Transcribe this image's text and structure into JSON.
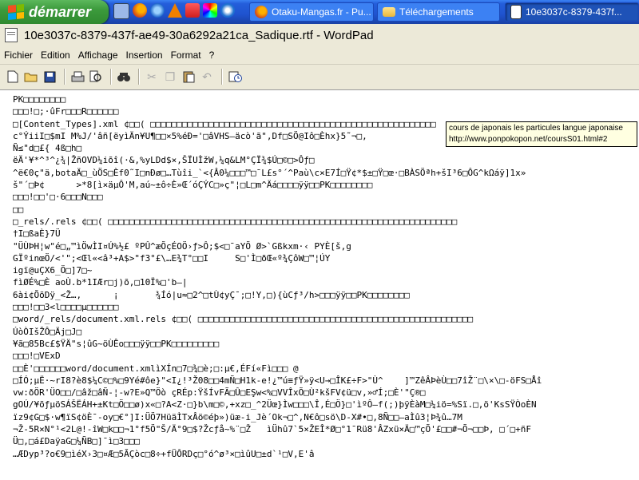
{
  "taskbar": {
    "start_label": "démarrer",
    "tasks": [
      {
        "label": "Otaku-Mangas.fr - Pu...",
        "icon": "firefox-icon"
      },
      {
        "label": "Téléchargements",
        "icon": "folder-icon"
      },
      {
        "label": "10e3037c-8379-437f...",
        "icon": "wordpad-doc-icon"
      }
    ]
  },
  "window": {
    "title": "10e3037c-8379-437f-ae49-30a6292a21ca_Sadique.rtf - WordPad"
  },
  "menu": [
    "Fichier",
    "Edition",
    "Affichage",
    "Insertion",
    "Format",
    "?"
  ],
  "tooltip": {
    "line1": "cours de japonais les particules langue japonaise",
    "line2": "http://www.ponpokopon.net/coursS01.html#2"
  },
  "document": {
    "lines": [
      "PK□□□□□□□□",
      "□□□!□;·ûFr□□□R□□□□□□",
      "□[Content_Types].xml ¢□□( □□□□□□□□□□□□□□□□□□□□□□□□□□□□□□□□□□□□□□□□□□□□□□□□□□□□□□",
      "c°ÝiiI□$mI M%J/'âñ[ëyìÄn¥U¶□□×5%éÐ='□âVHS—äcò'ã\",Df□SÖ@Iô□Èhx}5˜¬□,",
      "Ñ≤\"d□£{ 4ß□h□",
      "ëÄ'¥*^³^¿¾|ŽñOVD¼iõî(·&,%yLDd$×,ŠÏUÌžW,¼q&LM°ÇÏ¾$Ú□©□>Ôƒ□",
      "^ë€0ç\"ä,botaÄ□_ùÖS□Èf0˜I□nÐø□…Tùîi_`<{Â0¼□□□™□¯L£s°´^Paù\\c×E7Í□Ÿ¢*$±□Ÿ□œ·□BÀSÖªh+šI³6□ÔG^kΩáÿ]1x»",
      "š\"´□Þ¢      >*8[ì×äµÔ'M,aú~±ô÷È»Œ´óÇÝC□»ç\"¦□L□m^Äá□□□□ÿÿ□□PK□□□□□□□□",
      "□□□!□□'□·6□□□N□□□",
      "□□",
      "□_rels/.rels ¢□□( □□□□□□□□□□□□□□□□□□□□□□□□□□□□□□□□□□□□□□□□□□□□□□□□□□□□□□□□□□□□□□□□□□",
      "†I□ßaÈ}7Ü",
      "\"ÜÙÞH¦w\"é□„™ìÖwÌI¤Ú%½£ ºPÛ^æÕçÉOÖ›ƒ>Ô;$<□¯aYÕ Ø>`Gßkxm·‹ PYÈ[š,g",
      "GÏºinœÖ/<'\";<Œl«<â³+A$>\"f3°£\\…E¾T°□□I     S□'Ì□ðŒ«º¾ÇôW□™¦ÚY",
      "igï@uÇX6_Ö□]7□~",
      "fìØÉ%□È aoÙ.b*1IÆr□j)õ,□10Ï%□'b–|",
      "6ài¢ÕõDÿ_<Ž…,      ¡       ¾Íó|u≈□2^□tÙ¢yÇ¯;□!Y,□){ùCƒ³/h>□□□ÿÿ□□PK□□□□□□□□",
      "□□□!□□3<l□□□□µ□□□□□□",
      "□word/_rels/document.xml.rels ¢□□( □□□□□□□□□□□□□□□□□□□□□□□□□□□□□□□□□□□□□□□□□□□□□□□□□□□□",
      "ÚòÒIšŽÔ□Äj□J□",
      "¥ã□85Bc£$ŸÄ\"s¦ûG~öÙÊo□□□ÿÿ□□PK□□□□□□□□□",
      "□□□!□VExD",
      "□□È'□□□□□□word/document.xmlìXÍn□7□¾□è;□:µ€,ÉFí«Fì□□□ @",
      "□ÍÓ;µË·~rI8?è8$¼C©□%□9Yé#ôe}\"<I¿!³Ž08□□4mÑ□H1k-e!¿™ú≡ƒŸ»ÿ<U→□ÎK£÷F>\"Ù^    ]™ZêÂÞèÙ□□7îŽ¨□\\×\\□-öFS□Åî",
      "vw:ðÖR'ÜO□□/□âž□âÑ-¦-w?E»Q™Öò çRÉp:ŸšÍvFÃ□Û□EŞw<%□VVÎxÕ□Ù²kšFV¢ü□v,»♂Í;□È'\"Ç®□",
      "gOÚ/¥õƒµöSÁŠËÁH+±Kt□Ö□□ø)x«□?A<Z·□}b\\m□©,+xz□_^2Üœ}Ìw□□□\\Î,É□Ö}□'ìºÔ—f(;)þÿÈàM□¼iö=%Sï.□,ö'KsSŸÒoÈN",
      "ïz9¢G□$·w¶ïS¢öÈ¯-oy□€°]I:ÜÖ7HüäÌTxÂö©éþ»)üæ-i_Jè´Ok¬□^,N€ô□sö\\D-X#•□,8Ñ□□—aÌû3¦Þ¾û…7M",
      "¬Ž-5R×N°¹<2L@!-îW□k□□¬1°f5Ö\"Š/Ä°9□$?Žcƒå~%¨□Ž   ìÜhû7`5×ŽEÎ*Ø□°1¯Rü8'ÂZxü×Ä□™çÕ'£□□#¬Õ¬□□Þ, □´□+ñF",
      "Ü□,□á£DaÿaG□¼ÑB□]¯ì□3□□□",
      "…ÆDyp³?o€9□ìéX›3□¤Æ□5ÃÇòc□8÷+fÜÔRDç□°ó^ø³×□ìûU□±d`¹□V,E'â"
    ]
  }
}
